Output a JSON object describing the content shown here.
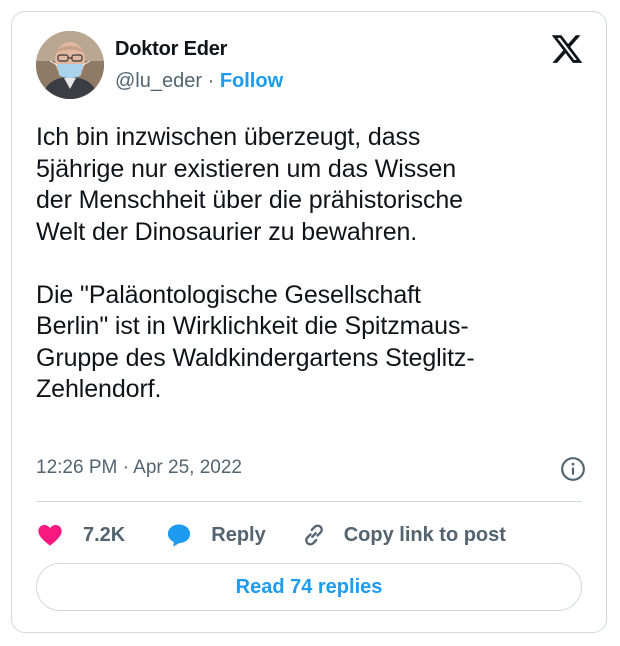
{
  "author": {
    "display_name": "Doktor Eder",
    "handle": "@lu_eder",
    "separator": " · ",
    "follow_label": "Follow",
    "avatar_icon": "profile-photo-masked-man"
  },
  "platform_icon": "x-logo-icon",
  "tweet": {
    "paragraphs": [
      "Ich bin inzwischen überzeugt, dass\n5jährige nur existieren um das Wissen\nder Menschheit über die prähistorische\nWelt der Dinosaurier zu bewahren.",
      "Die \"Paläontologische Gesellschaft\nBerlin\" ist in Wirklichkeit die Spitzmaus-\nGruppe des Waldkindergartens Steglitz-\nZehlendorf."
    ],
    "timestamp": "12:26 PM · Apr 25, 2022"
  },
  "actions": {
    "like_count": "7.2K",
    "reply_label": "Reply",
    "copy_link_label": "Copy link to post"
  },
  "read_replies_label": "Read 74 replies",
  "colors": {
    "accent": "#1d9bf0",
    "like": "#f91880",
    "text_primary": "#0f1419",
    "text_secondary": "#536471",
    "border": "#cfd9de"
  }
}
